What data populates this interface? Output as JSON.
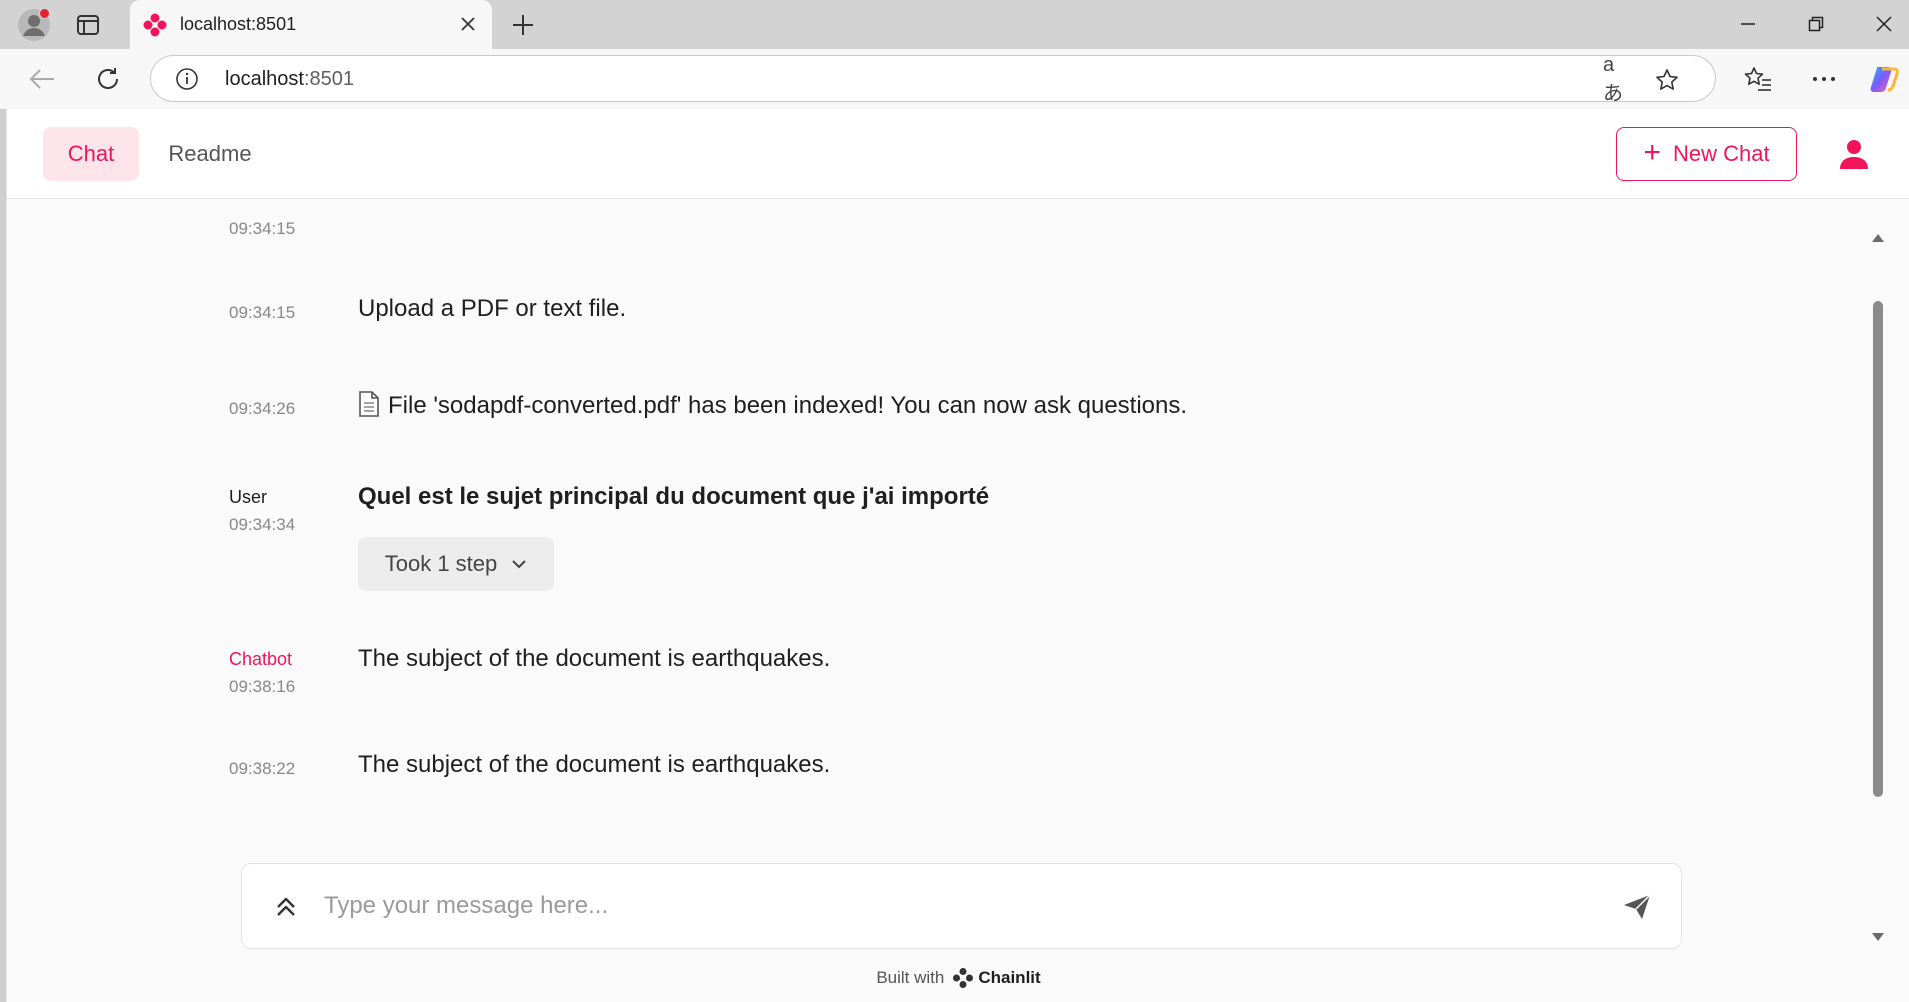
{
  "browser": {
    "tab_title": "localhost:8501",
    "url_host": "localhost",
    "url_port": ":8501",
    "translate_glyph": "aあ"
  },
  "header": {
    "nav": [
      {
        "label": "Chat"
      },
      {
        "label": "Readme"
      }
    ],
    "new_chat_label": "New Chat"
  },
  "messages": [
    {
      "author": "",
      "time": "09:34:15",
      "text": ""
    },
    {
      "author": "",
      "time": "09:34:15",
      "text": "Upload a PDF or text file."
    },
    {
      "author": "",
      "time": "09:34:26",
      "text": "File 'sodapdf-converted.pdf' has been indexed! You can now ask questions.",
      "icon": "document-icon"
    },
    {
      "author": "User",
      "time": "09:34:34",
      "text": "Quel est le sujet principal du document que j'ai importé",
      "step_label": "Took 1 step"
    },
    {
      "author": "Chatbot",
      "time": "09:38:16",
      "text": "The subject of the document is earthquakes."
    },
    {
      "author": "",
      "time": "09:38:22",
      "text": "The subject of the document is earthquakes."
    }
  ],
  "composer": {
    "placeholder": "Type your message here...",
    "value": ""
  },
  "footer": {
    "built_with": "Built with",
    "brand": "Chainlit"
  },
  "colors": {
    "accent": "#f0145a",
    "accent_soft": "#fde4eb",
    "background": "#fafafa"
  }
}
